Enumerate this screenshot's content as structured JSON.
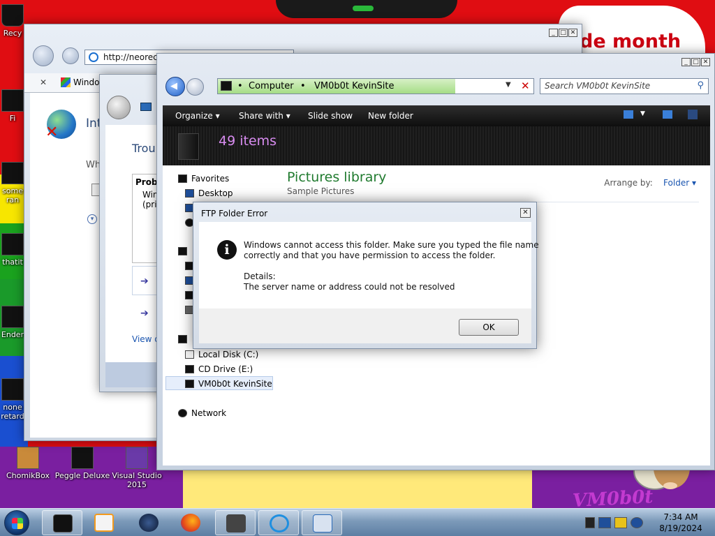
{
  "desktop": {
    "wallpaper_text": "de month",
    "wallpaper_logo": "VM0b0t",
    "icons": [
      {
        "label": "Recy"
      },
      {
        "label": "Fi"
      },
      {
        "label": "some"
      },
      {
        "label": "ran"
      },
      {
        "label": "thatit"
      },
      {
        "label": "Ender"
      },
      {
        "label": "none"
      },
      {
        "label": "retard"
      },
      {
        "label": "ChomikBox"
      },
      {
        "label": "Peggle Deluxe"
      },
      {
        "label": "Visual Studio 2015"
      }
    ]
  },
  "ie_window": {
    "address": "http://neoreco",
    "tab_label": "Windo",
    "heading_partial": "Int",
    "text_partial": "Wh"
  },
  "troubleshoot_window": {
    "title": "Troub",
    "box_heading": "Proble",
    "box_line1": "Win",
    "box_line2": "(prin",
    "link": "View d"
  },
  "explorer": {
    "breadcrumb": [
      "Computer",
      "VM0b0t KevinSite"
    ],
    "search_placeholder": "Search VM0b0t KevinSite",
    "toolbar": {
      "organize": "Organize",
      "share_with": "Share with",
      "slide_show": "Slide show",
      "new_folder": "New folder"
    },
    "item_count": "49 items",
    "library_title": "Pictures library",
    "library_subtitle": "Sample Pictures",
    "arrange_label": "Arrange by:",
    "arrange_value": "Folder",
    "nav": {
      "favorites": "Favorites",
      "desktop": "Desktop",
      "local_disk": "Local Disk (C:)",
      "cd_drive": "CD Drive (E:)",
      "site": "VM0b0t KevinSite",
      "network": "Network"
    }
  },
  "dialog": {
    "title": "FTP Folder Error",
    "message_line1": "Windows cannot access this folder. Make sure you typed the file name",
    "message_line2": "correctly and that you have permission to access the folder.",
    "details_label": "Details:",
    "details_text": "The server name or address could not be resolved",
    "ok_label": "OK"
  },
  "taskbar": {
    "time": "7:34 AM",
    "date": "8/19/2024"
  },
  "colors": {
    "wallpaper_red": "#e00d12",
    "library_green": "#1f7a2e",
    "item_count_pink": "#d88cf0",
    "link_blue": "#1a55b0"
  }
}
